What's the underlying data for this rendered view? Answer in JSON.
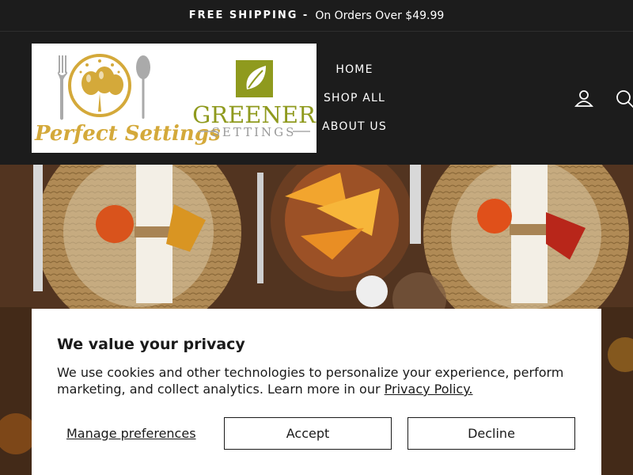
{
  "announcement": {
    "strong": "FREE SHIPPING -",
    "text": "On Orders Over $49.99"
  },
  "logo": {
    "perfect": "Perfect Settings",
    "greener_top": "GREENER",
    "greener_bottom": "SETTINGS"
  },
  "nav": {
    "items": [
      "HOME",
      "SHOP ALL",
      "ABOUT US"
    ]
  },
  "icons": {
    "account": "account-icon",
    "search": "search-icon"
  },
  "privacy": {
    "title": "We value your privacy",
    "body": "We use cookies and other technologies to personalize your experience, perform marketing, and collect analytics. Learn more in our ",
    "link": "Privacy Policy.",
    "manage": "Manage preferences",
    "accept": "Accept",
    "decline": "Decline"
  },
  "colors": {
    "header_bg": "#1c1c1c",
    "gold": "#d4a93a",
    "olive": "#8f9a1e",
    "white": "#ffffff"
  }
}
